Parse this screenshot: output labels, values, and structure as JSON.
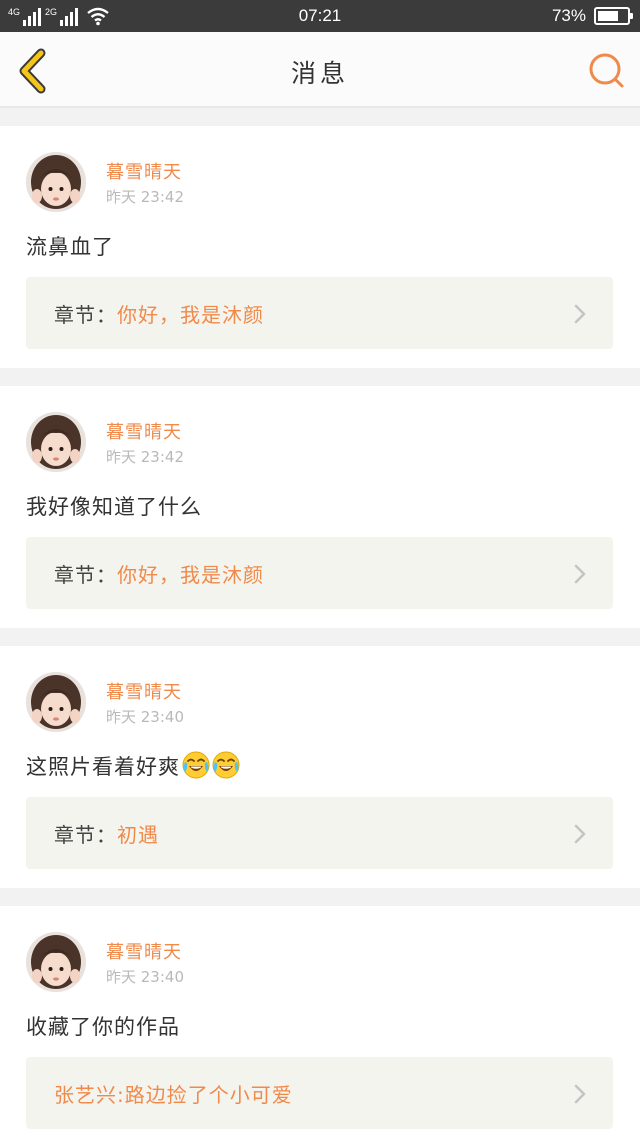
{
  "status_bar": {
    "network_1": "4G",
    "network_2": "2G",
    "time": "07:21",
    "battery_text": "73%",
    "battery_level": 0.73
  },
  "header": {
    "title": "消息",
    "back_icon": "chevron-left-icon",
    "search_icon": "search-icon"
  },
  "colors": {
    "accent": "#f08a4b",
    "back_icon": "#f5c518",
    "chapter_bg": "#f4f4ee"
  },
  "messages": [
    {
      "user": "暮雪晴天",
      "time": "昨天 23:42",
      "text": "流鼻血了",
      "link_prefix": "章节：",
      "link_title": "你好，我是沐颜"
    },
    {
      "user": "暮雪晴天",
      "time": "昨天 23:42",
      "text": "我好像知道了什么",
      "link_prefix": "章节：",
      "link_title": "你好，我是沐颜"
    },
    {
      "user": "暮雪晴天",
      "time": "昨天 23:40",
      "text": "这照片看着好爽",
      "emojis": [
        "tears-of-joy-emoji",
        "tears-of-joy-emoji"
      ],
      "link_prefix": "章节：",
      "link_title": "初遇"
    },
    {
      "user": "暮雪晴天",
      "time": "昨天 23:40",
      "text": "收藏了你的作品",
      "link_prefix": "",
      "link_title": "张艺兴:路边捡了个小可爱"
    }
  ]
}
